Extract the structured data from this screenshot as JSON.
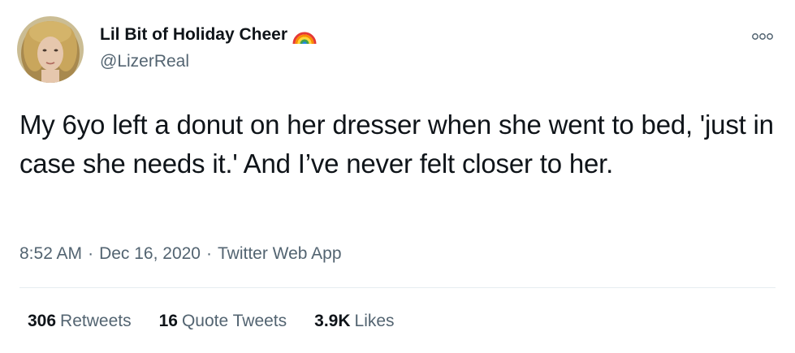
{
  "author": {
    "display_name": "Lil Bit of Holiday Cheer",
    "badge_icon": "rainbow-icon",
    "handle": "@LizerReal"
  },
  "tweet": {
    "text": "My 6yo left a donut on her dresser when she went to bed, 'just in case she needs it.' And I’ve never felt closer to her."
  },
  "meta": {
    "time": "8:52 AM",
    "separator": "·",
    "date": "Dec 16, 2020",
    "source": "Twitter Web App"
  },
  "stats": {
    "retweets": {
      "count": "306",
      "label": "Retweets"
    },
    "quote_tweets": {
      "count": "16",
      "label": "Quote Tweets"
    },
    "likes": {
      "count": "3.9K",
      "label": "Likes"
    }
  },
  "colors": {
    "text_primary": "#0f1419",
    "text_secondary": "#536471",
    "divider": "#e6ecf0"
  }
}
